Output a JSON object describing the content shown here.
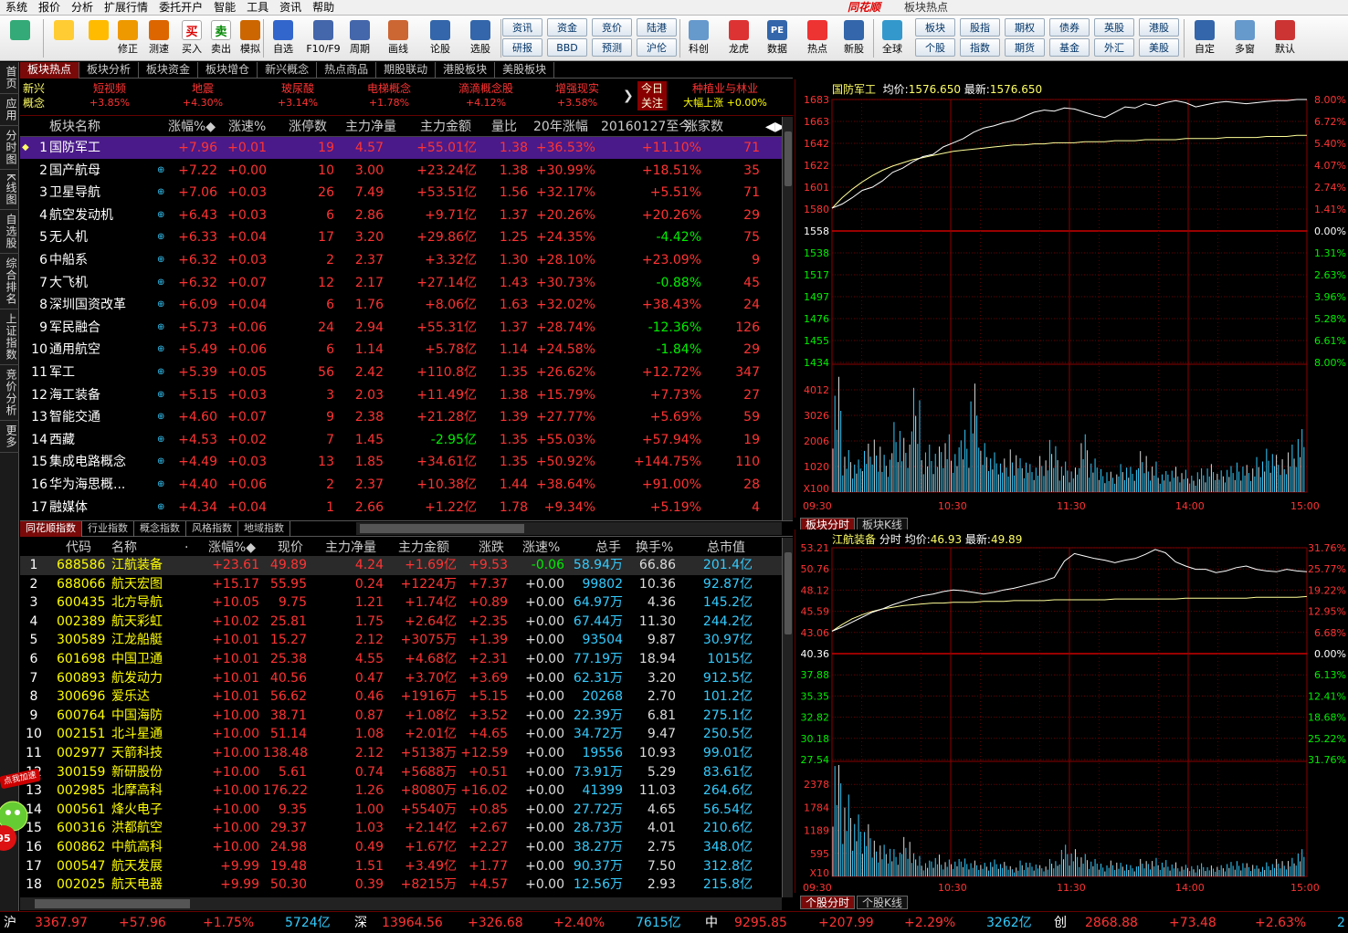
{
  "app": {
    "brand": "同花顺",
    "title": "板块热点"
  },
  "menu": [
    "系统",
    "报价",
    "分析",
    "扩展行情",
    "委托开户",
    "智能",
    "工具",
    "资讯",
    "帮助"
  ],
  "toolbar": {
    "big": [
      {
        "label": "",
        "icon": "grid-icon"
      },
      {
        "label": "",
        "icon": "back-icon"
      },
      {
        "label": "",
        "icon": "updown-icon"
      },
      {
        "label": "修正",
        "icon": "clock-icon"
      },
      {
        "label": "测速",
        "icon": "speed-icon"
      },
      {
        "label": "买入",
        "icon": "buy-icon",
        "glyph": "买"
      },
      {
        "label": "卖出",
        "icon": "sell-icon",
        "glyph": "卖"
      },
      {
        "label": "模拟",
        "icon": "hammer-icon"
      },
      {
        "label": "自选",
        "icon": "star-icon"
      },
      {
        "label": "F10/F9",
        "icon": "f10-icon"
      },
      {
        "label": "周期",
        "icon": "cycle-icon"
      },
      {
        "label": "画线",
        "icon": "pen-icon"
      },
      {
        "label": "论股",
        "icon": "forum-icon"
      },
      {
        "label": "选股",
        "icon": "pick-icon"
      }
    ],
    "grid1": [
      "资讯",
      "资金",
      "竞价",
      "陆港",
      "研报",
      "BBD",
      "预测",
      "沪伦"
    ],
    "mid": [
      {
        "label": "科创",
        "icon": "kechuang-icon"
      },
      {
        "label": "龙虎",
        "icon": "dragon-icon"
      },
      {
        "label": "数据",
        "icon": "pe-icon",
        "glyph": "PE"
      },
      {
        "label": "热点",
        "icon": "hot-icon"
      },
      {
        "label": "新股",
        "icon": "newstock-icon"
      },
      {
        "label": "全球",
        "icon": "globe-icon"
      }
    ],
    "grid2": [
      "板块",
      "股指",
      "期权",
      "债券",
      "英股",
      "港股",
      "个股",
      "指数",
      "期货",
      "基金",
      "外汇",
      "美股"
    ],
    "right": [
      {
        "label": "自定",
        "icon": "custom-icon"
      },
      {
        "label": "多窗",
        "icon": "multiwin-icon"
      },
      {
        "label": "默认",
        "icon": "home-icon"
      }
    ]
  },
  "leftnav": [
    "首页",
    "应用",
    "分时图",
    "K线图",
    "自选股",
    "综合排名",
    "上证指数",
    "竞价分析",
    "更多"
  ],
  "tabs_top": [
    "板块热点",
    "板块分析",
    "板块资金",
    "板块增仓",
    "新兴概念",
    "热点商品",
    "期股联动",
    "港股板块",
    "美股板块"
  ],
  "ticker": {
    "xinxing": "新兴概念",
    "items": [
      {
        "name": "短视频",
        "val": "+3.85%"
      },
      {
        "name": "地震",
        "val": "+4.30%"
      },
      {
        "name": "玻尿酸",
        "val": "+3.14%"
      },
      {
        "name": "电梯概念",
        "val": "+1.78%"
      },
      {
        "name": "滴滴概念股",
        "val": "+4.12%"
      },
      {
        "name": "增强现实",
        "val": "+3.58%"
      }
    ],
    "today": "今日关注",
    "focus_name": "种植业与林业",
    "focus_val": "大幅上涨 +0.00%"
  },
  "table1": {
    "headers": [
      "板块名称",
      "涨幅%◆",
      "涨速%",
      "涨停数",
      "主力净量",
      "主力金额",
      "量比",
      "20年涨幅",
      "20160127至今",
      "涨家数"
    ],
    "rows": [
      [
        "1",
        "国防军工",
        "+7.96",
        "+0.01",
        "19",
        "4.57",
        "+55.01亿",
        "1.38",
        "+36.53%",
        "+11.10%",
        "71"
      ],
      [
        "2",
        "国产航母",
        "+7.22",
        "+0.00",
        "10",
        "3.00",
        "+23.24亿",
        "1.38",
        "+30.99%",
        "+18.51%",
        "35"
      ],
      [
        "3",
        "卫星导航",
        "+7.06",
        "+0.03",
        "26",
        "7.49",
        "+53.51亿",
        "1.56",
        "+32.17%",
        "+5.51%",
        "71"
      ],
      [
        "4",
        "航空发动机",
        "+6.43",
        "+0.03",
        "6",
        "2.86",
        "+9.71亿",
        "1.37",
        "+20.26%",
        "+20.26%",
        "29"
      ],
      [
        "5",
        "无人机",
        "+6.33",
        "+0.04",
        "17",
        "3.20",
        "+29.86亿",
        "1.25",
        "+24.35%",
        "-4.42%",
        "75"
      ],
      [
        "6",
        "中船系",
        "+6.32",
        "+0.03",
        "2",
        "2.37",
        "+3.32亿",
        "1.30",
        "+28.10%",
        "+23.09%",
        "9"
      ],
      [
        "7",
        "大飞机",
        "+6.32",
        "+0.07",
        "12",
        "2.17",
        "+27.14亿",
        "1.43",
        "+30.73%",
        "-0.88%",
        "45"
      ],
      [
        "8",
        "深圳国资改革",
        "+6.09",
        "+0.04",
        "6",
        "1.76",
        "+8.06亿",
        "1.63",
        "+32.02%",
        "+38.43%",
        "24"
      ],
      [
        "9",
        "军民融合",
        "+5.73",
        "+0.06",
        "24",
        "2.94",
        "+55.31亿",
        "1.37",
        "+28.74%",
        "-12.36%",
        "126"
      ],
      [
        "10",
        "通用航空",
        "+5.49",
        "+0.06",
        "6",
        "1.14",
        "+5.78亿",
        "1.14",
        "+24.58%",
        "-1.84%",
        "29"
      ],
      [
        "11",
        "军工",
        "+5.39",
        "+0.05",
        "56",
        "2.42",
        "+110.8亿",
        "1.35",
        "+26.62%",
        "+12.72%",
        "347"
      ],
      [
        "12",
        "海工装备",
        "+5.15",
        "+0.03",
        "3",
        "2.03",
        "+11.49亿",
        "1.38",
        "+15.79%",
        "+7.73%",
        "27"
      ],
      [
        "13",
        "智能交通",
        "+4.60",
        "+0.07",
        "9",
        "2.38",
        "+21.28亿",
        "1.39",
        "+27.77%",
        "+5.69%",
        "59"
      ],
      [
        "14",
        "西藏",
        "+4.53",
        "+0.02",
        "7",
        "1.45",
        "-2.95亿",
        "1.35",
        "+55.03%",
        "+57.94%",
        "19"
      ],
      [
        "15",
        "集成电路概念",
        "+4.49",
        "+0.03",
        "13",
        "1.85",
        "+34.61亿",
        "1.35",
        "+50.92%",
        "+144.75%",
        "110"
      ],
      [
        "16",
        "华为海思概...",
        "+4.40",
        "+0.06",
        "2",
        "2.37",
        "+10.38亿",
        "1.44",
        "+38.64%",
        "+91.00%",
        "28"
      ],
      [
        "17",
        "融媒体",
        "+4.34",
        "+0.04",
        "1",
        "2.66",
        "+1.22亿",
        "1.78",
        "+9.34%",
        "+5.19%",
        "4"
      ]
    ]
  },
  "tabs_mid": [
    "同花顺指数",
    "行业指数",
    "概念指数",
    "风格指数",
    "地域指数"
  ],
  "table2": {
    "headers": [
      "代码",
      "名称",
      "·",
      "涨幅%◆",
      "现价",
      "主力净量",
      "主力金额",
      "涨跌",
      "涨速%",
      "总手",
      "换手%",
      "总市值"
    ],
    "rows": [
      [
        "1",
        "688586",
        "江航装备",
        "+23.61",
        "49.89",
        "4.24",
        "+1.69亿",
        "+9.53",
        "-0.06",
        "58.94万",
        "66.86",
        "201.4亿"
      ],
      [
        "2",
        "688066",
        "航天宏图",
        "+15.17",
        "55.95",
        "0.24",
        "+1224万",
        "+7.37",
        "+0.00",
        "99802",
        "10.36",
        "92.87亿"
      ],
      [
        "3",
        "600435",
        "北方导航",
        "+10.05",
        "9.75",
        "1.21",
        "+1.74亿",
        "+0.89",
        "+0.00",
        "64.97万",
        "4.36",
        "145.2亿"
      ],
      [
        "4",
        "002389",
        "航天彩虹",
        "+10.02",
        "25.81",
        "1.75",
        "+2.64亿",
        "+2.35",
        "+0.00",
        "67.44万",
        "11.30",
        "244.2亿"
      ],
      [
        "5",
        "300589",
        "江龙船艇",
        "+10.01",
        "15.27",
        "2.12",
        "+3075万",
        "+1.39",
        "+0.00",
        "93504",
        "9.87",
        "30.97亿"
      ],
      [
        "6",
        "601698",
        "中国卫通",
        "+10.01",
        "25.38",
        "4.55",
        "+4.68亿",
        "+2.31",
        "+0.00",
        "77.19万",
        "18.94",
        "1015亿"
      ],
      [
        "7",
        "600893",
        "航发动力",
        "+10.01",
        "40.56",
        "0.47",
        "+3.70亿",
        "+3.69",
        "+0.00",
        "62.31万",
        "3.20",
        "912.5亿"
      ],
      [
        "8",
        "300696",
        "爱乐达",
        "+10.01",
        "56.62",
        "0.46",
        "+1916万",
        "+5.15",
        "+0.00",
        "20268",
        "2.70",
        "101.2亿"
      ],
      [
        "9",
        "600764",
        "中国海防",
        "+10.00",
        "38.71",
        "0.87",
        "+1.08亿",
        "+3.52",
        "+0.00",
        "22.39万",
        "6.81",
        "275.1亿"
      ],
      [
        "10",
        "002151",
        "北斗星通",
        "+10.00",
        "51.14",
        "1.08",
        "+2.01亿",
        "+4.65",
        "+0.00",
        "34.72万",
        "9.47",
        "250.5亿"
      ],
      [
        "11",
        "002977",
        "天箭科技",
        "+10.00",
        "138.48",
        "2.12",
        "+5138万",
        "+12.59",
        "+0.00",
        "19556",
        "10.93",
        "99.01亿"
      ],
      [
        "12",
        "300159",
        "新研股份",
        "+10.00",
        "5.61",
        "0.74",
        "+5688万",
        "+0.51",
        "+0.00",
        "73.91万",
        "5.29",
        "83.61亿"
      ],
      [
        "13",
        "002985",
        "北摩高科",
        "+10.00",
        "176.22",
        "1.26",
        "+8080万",
        "+16.02",
        "+0.00",
        "41399",
        "11.03",
        "264.6亿"
      ],
      [
        "14",
        "000561",
        "烽火电子",
        "+10.00",
        "9.35",
        "1.00",
        "+5540万",
        "+0.85",
        "+0.00",
        "27.72万",
        "4.65",
        "56.54亿"
      ],
      [
        "15",
        "600316",
        "洪都航空",
        "+10.00",
        "29.37",
        "1.03",
        "+2.14亿",
        "+2.67",
        "+0.00",
        "28.73万",
        "4.01",
        "210.6亿"
      ],
      [
        "16",
        "600862",
        "中航高科",
        "+10.00",
        "24.98",
        "0.49",
        "+1.67亿",
        "+2.27",
        "+0.00",
        "38.27万",
        "2.75",
        "348.0亿"
      ],
      [
        "17",
        "000547",
        "航天发展",
        "+9.99",
        "19.48",
        "1.51",
        "+3.49亿",
        "+1.77",
        "+0.00",
        "90.37万",
        "7.50",
        "312.8亿"
      ],
      [
        "18",
        "002025",
        "航天电器",
        "+9.99",
        "50.30",
        "0.39",
        "+8215万",
        "+4.57",
        "+0.00",
        "12.56万",
        "2.93",
        "215.8亿"
      ]
    ]
  },
  "promo": {
    "text": "点我加速",
    "badge": "95"
  },
  "chart1": {
    "name": "国防军工",
    "avg_label": "均价:",
    "avg": "1576.650",
    "last_label": "最新:",
    "last": "1576.650",
    "price_ticks": [
      "1683",
      "1663",
      "1642",
      "1622",
      "1601",
      "1580",
      "1558",
      "1538",
      "1517",
      "1497",
      "1476",
      "1455",
      "1434"
    ],
    "pct_ticks": [
      "8.00%",
      "6.72%",
      "5.40%",
      "4.07%",
      "2.74%",
      "1.41%",
      "0.00%",
      "1.31%",
      "2.63%",
      "3.96%",
      "5.28%",
      "6.61%",
      "8.00%"
    ],
    "vol_ticks": [
      "4012",
      "3026",
      "2006",
      "1020"
    ],
    "vol_unit": "X100",
    "times": [
      "09:30",
      "10:30",
      "11:30",
      "14:00",
      "15:00"
    ],
    "tabs": [
      "板块分时",
      "板块K线"
    ],
    "prev_close": 1558,
    "range": [
      1434,
      1683
    ],
    "vol_max": 4500,
    "price_series": [
      1580,
      1584,
      1590,
      1597,
      1600,
      1606,
      1614,
      1618,
      1624,
      1629,
      1631,
      1638,
      1642,
      1646,
      1652,
      1656,
      1658,
      1661,
      1663,
      1667,
      1671,
      1673,
      1672,
      1675,
      1674,
      1671,
      1668,
      1666,
      1671,
      1676,
      1675,
      1679,
      1677,
      1680,
      1682,
      1680,
      1676,
      1678,
      1680,
      1681,
      1680,
      1679,
      1680,
      1681,
      1682,
      1682,
      1683,
      1683
    ],
    "avg_series": [
      1580,
      1590,
      1598,
      1605,
      1611,
      1616,
      1620,
      1623,
      1626,
      1628,
      1630,
      1632,
      1634,
      1635,
      1636,
      1637,
      1638,
      1639,
      1640,
      1640,
      1641,
      1641,
      1642,
      1642,
      1642,
      1643,
      1643,
      1643,
      1644,
      1644,
      1644,
      1645,
      1645,
      1645,
      1645,
      1646,
      1646,
      1646,
      1646,
      1647,
      1647,
      1647,
      1647,
      1648,
      1648,
      1648,
      1649,
      1649
    ],
    "vol_series": [
      3400,
      1200,
      900,
      1300,
      1600,
      1100,
      2000,
      1500,
      2800,
      1400,
      1300,
      1600,
      1200,
      1900,
      3200,
      1400,
      1100,
      900,
      1300,
      1000,
      800,
      1000,
      1400,
      900,
      700,
      1600,
      900,
      700,
      600,
      800,
      700,
      1100,
      900,
      600,
      700,
      600,
      500,
      700,
      800,
      600,
      700,
      900,
      800,
      1000,
      1200,
      1000,
      1400,
      1800
    ]
  },
  "chart2": {
    "name": "江航装备",
    "mode": "分时",
    "avg_label": "均价:",
    "avg": "46.93",
    "last_label": "最新:",
    "last": "49.89",
    "price_ticks": [
      "53.21",
      "50.76",
      "48.12",
      "45.59",
      "43.06",
      "40.36",
      "37.88",
      "35.35",
      "32.82",
      "30.18",
      "27.54"
    ],
    "pct_ticks": [
      "31.76%",
      "25.77%",
      "19.22%",
      "12.95%",
      "6.68%",
      "0.00%",
      "6.13%",
      "12.41%",
      "18.68%",
      "25.22%",
      "31.76%"
    ],
    "vol_ticks": [
      "2378",
      "1784",
      "1189",
      "595"
    ],
    "vol_unit": "X10",
    "times": [
      "09:30",
      "10:30",
      "11:30",
      "14:00",
      "15:00"
    ],
    "tabs": [
      "个股分时",
      "个股K线"
    ],
    "prev_close": 40.36,
    "range": [
      27.54,
      53.21
    ],
    "vol_max": 2600,
    "price_series": [
      43.1,
      43.6,
      44.2,
      44.8,
      45.4,
      45.8,
      46.3,
      46.7,
      47.1,
      47.4,
      47.6,
      47.9,
      48.1,
      48.0,
      47.8,
      47.6,
      47.8,
      48.1,
      48.3,
      48.6,
      48.9,
      49.2,
      49.6,
      51.6,
      52.5,
      52.2,
      51.9,
      51.7,
      51.4,
      51.7,
      51.9,
      52.4,
      53.0,
      52.6,
      51.5,
      51.0,
      50.6,
      50.6,
      50.2,
      50.4,
      50.8,
      51.0,
      50.6,
      50.4,
      50.3,
      50.6,
      50.4,
      50.3
    ],
    "avg_series": [
      43.1,
      43.9,
      44.6,
      45.1,
      45.5,
      45.8,
      46.0,
      46.2,
      46.3,
      46.4,
      46.5,
      46.5,
      46.6,
      46.6,
      46.6,
      46.7,
      46.7,
      46.7,
      46.8,
      46.8,
      46.8,
      46.8,
      46.9,
      46.9,
      46.9,
      46.9,
      46.9,
      46.9,
      47.0,
      47.0,
      47.0,
      47.0,
      47.0,
      47.0,
      47.0,
      47.1,
      47.1,
      47.1,
      47.1,
      47.1,
      47.1,
      47.1,
      47.2,
      47.2,
      47.2,
      47.2,
      47.2,
      47.3
    ],
    "vol_series": [
      2500,
      1500,
      1100,
      900,
      700,
      600,
      500,
      700,
      400,
      300,
      400,
      300,
      300,
      350,
      300,
      250,
      300,
      250,
      200,
      300,
      250,
      200,
      300,
      600,
      500,
      400,
      300,
      250,
      300,
      250,
      200,
      300,
      350,
      300,
      250,
      200,
      200,
      250,
      200,
      200,
      250,
      300,
      250,
      200,
      250,
      300,
      350,
      500
    ]
  },
  "statusbar": [
    {
      "ex": "沪",
      "val": "3367.97",
      "chg": "+57.96",
      "pct": "+1.75%",
      "amt": "5724亿"
    },
    {
      "ex": "深",
      "val": "13964.56",
      "chg": "+326.68",
      "pct": "+2.40%",
      "amt": "7615亿"
    },
    {
      "ex": "中",
      "val": "9295.85",
      "chg": "+207.99",
      "pct": "+2.29%",
      "amt": "3262亿"
    },
    {
      "ex": "创",
      "val": "2868.88",
      "chg": "+73.48",
      "pct": "+2.63%",
      "amt": "2"
    }
  ],
  "colors": {
    "up": "#ff3333",
    "down": "#00ee00",
    "sel1": "#4a1a8a",
    "grid": "#8b0000"
  }
}
